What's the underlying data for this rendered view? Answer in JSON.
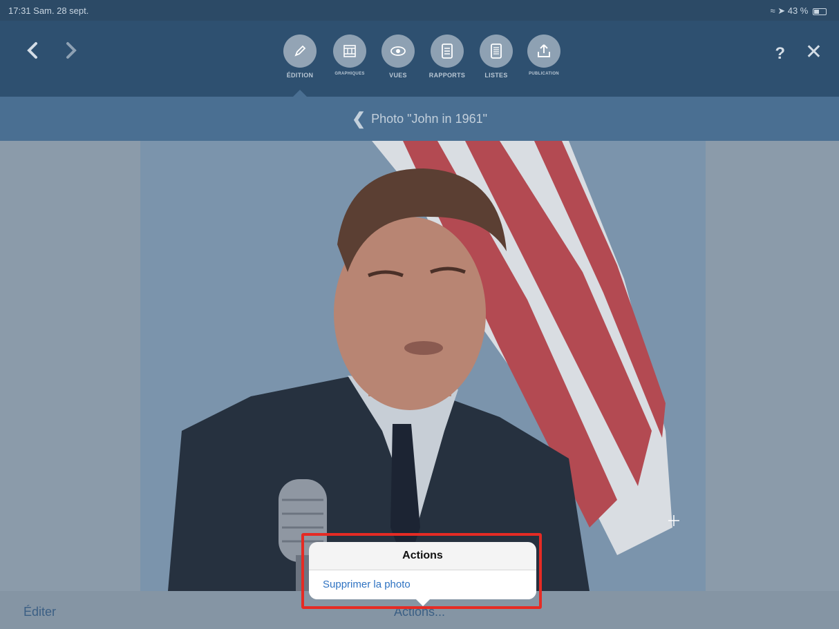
{
  "status": {
    "time_date": "17:31  Sam. 28 sept.",
    "battery": "43 %"
  },
  "toolbar": {
    "back_icon": "chevron-left-icon",
    "forward_icon": "chevron-right-icon",
    "tools": [
      {
        "label": "ÉDITION",
        "icon": "pencil-icon"
      },
      {
        "label": "GRAPHIQUES",
        "icon": "graphics-icon"
      },
      {
        "label": "VUES",
        "icon": "eye-icon"
      },
      {
        "label": "RAPPORTS",
        "icon": "document-icon"
      },
      {
        "label": "LISTES",
        "icon": "list-icon"
      },
      {
        "label": "PUBLICATION",
        "icon": "upload-icon"
      }
    ],
    "help": "?",
    "close": "✕"
  },
  "subheader": {
    "title": "Photo  \"John in 1961\""
  },
  "bottombar": {
    "edit": "Éditer",
    "actions": "Actions..."
  },
  "popover": {
    "title": "Actions",
    "item": "Supprimer la photo"
  },
  "colors": {
    "toolbar": "#2e5070",
    "subheader": "#4a6f92",
    "accent": "#2f73c2",
    "highlight": "#e52b24"
  }
}
